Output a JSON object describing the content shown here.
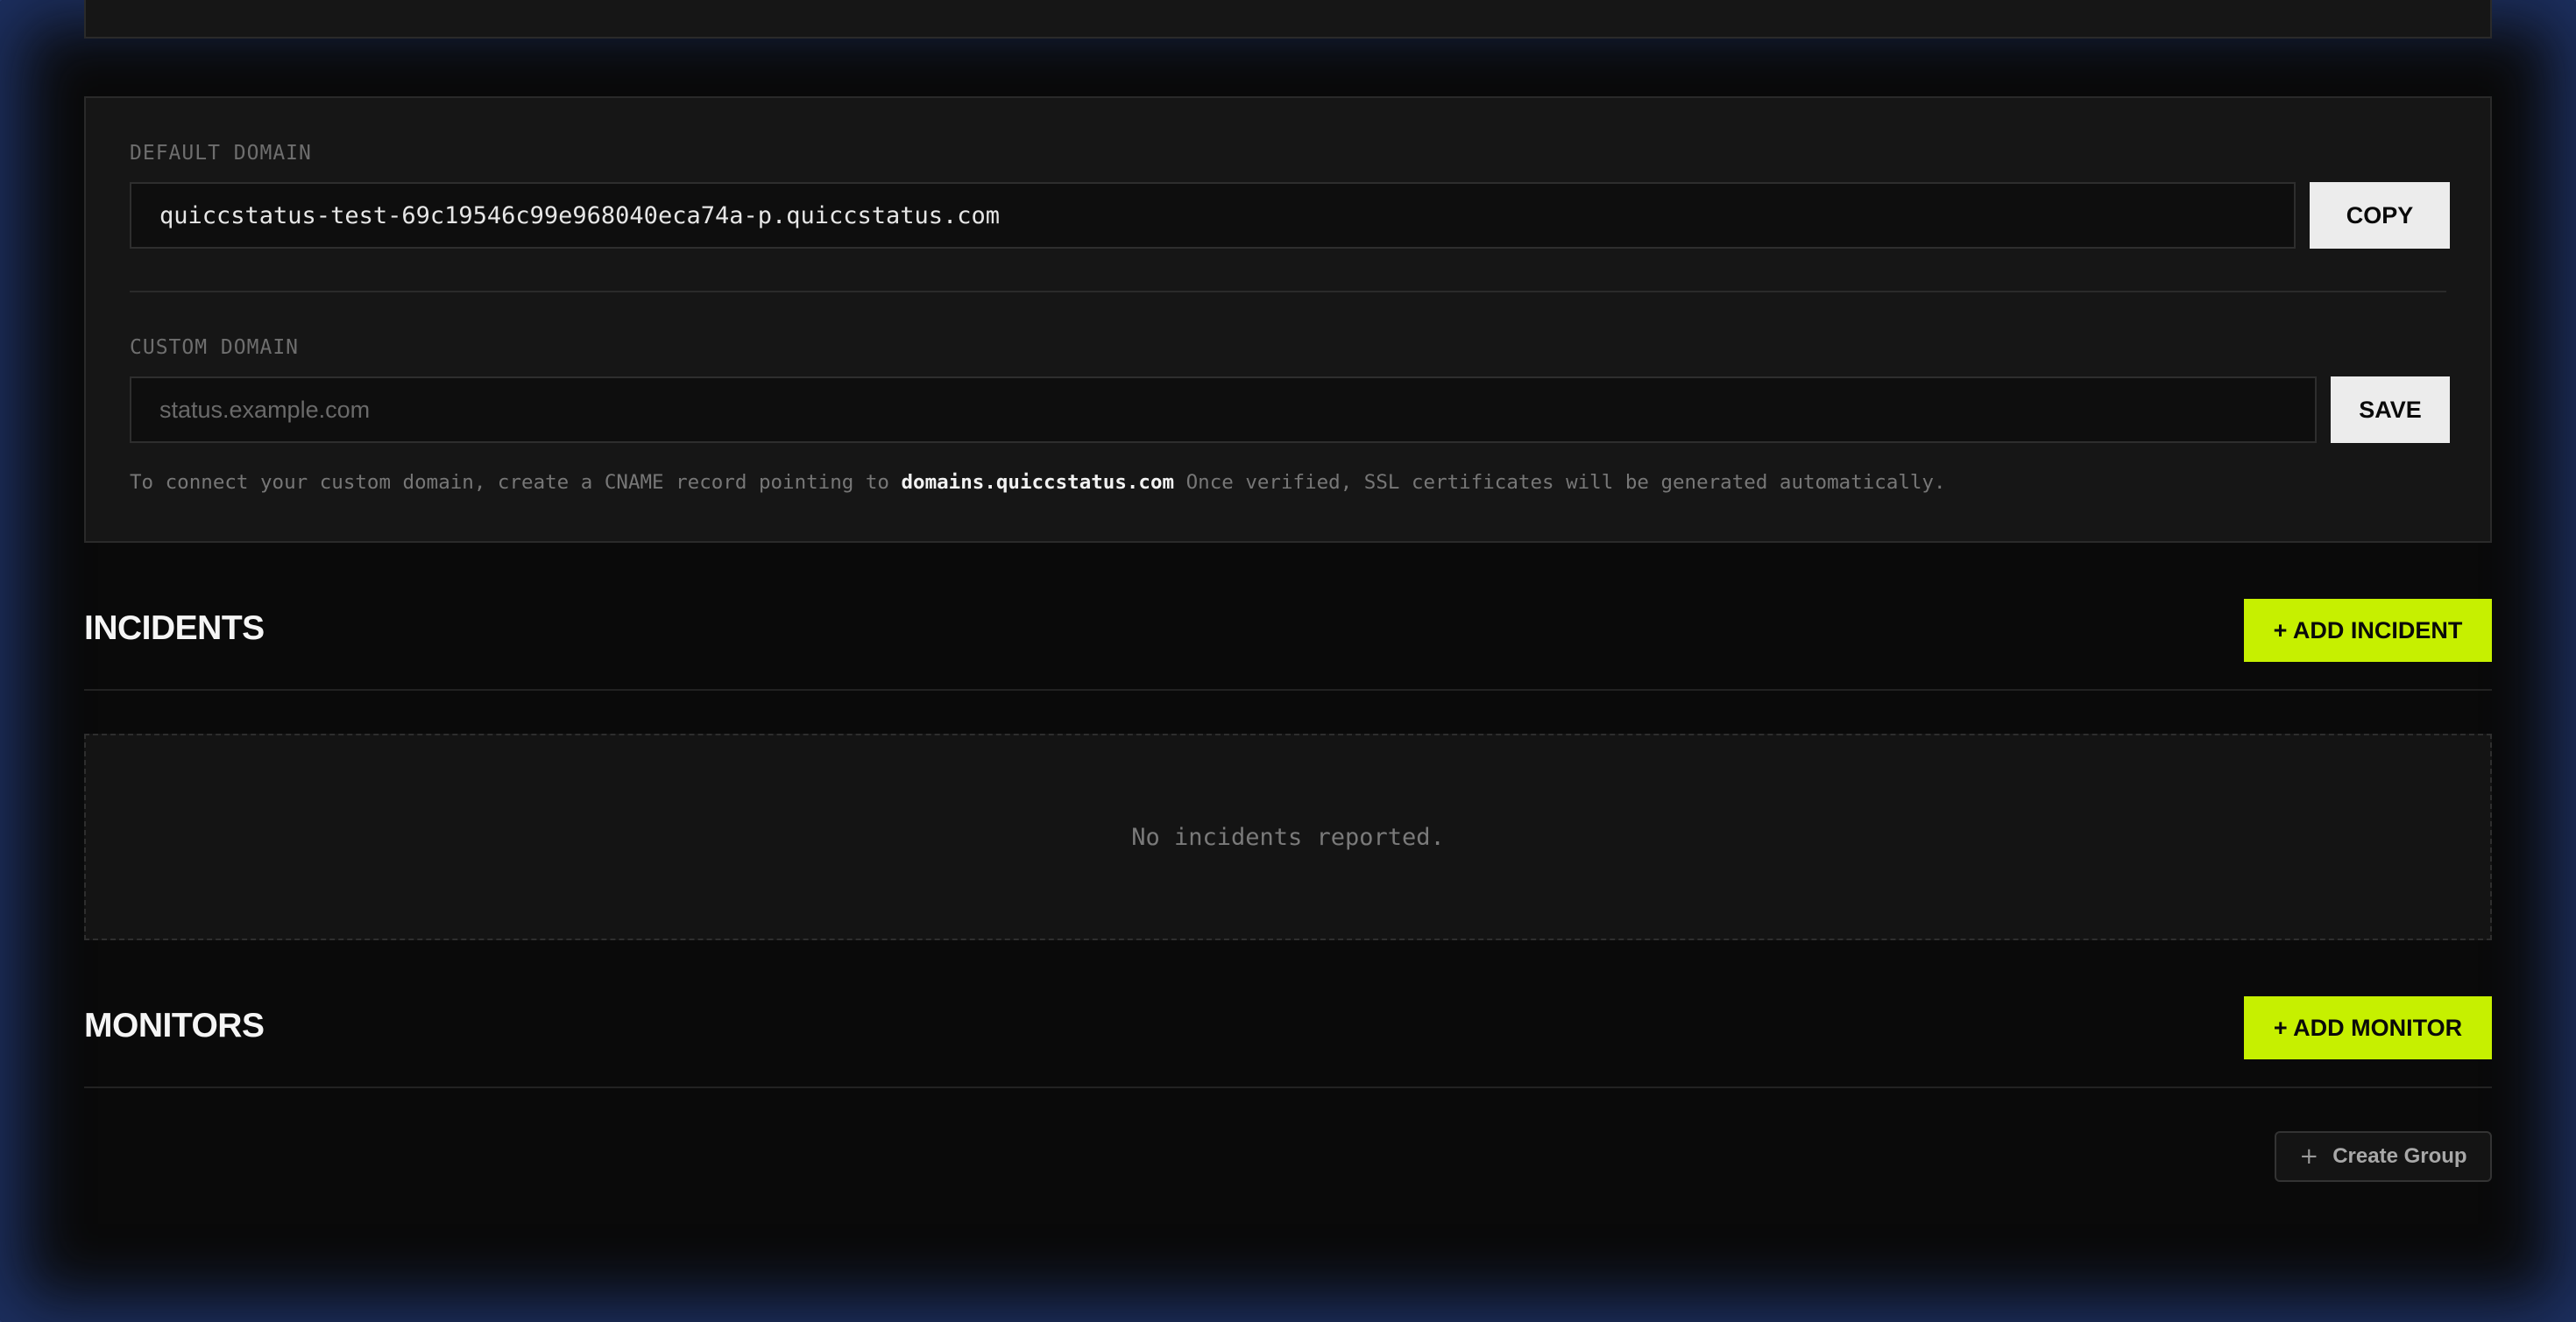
{
  "default_domain": {
    "label": "DEFAULT DOMAIN",
    "value": "quiccstatus-test-69c19546c99e968040eca74a-p.quiccstatus.com",
    "copy_label": "COPY"
  },
  "custom_domain": {
    "label": "CUSTOM DOMAIN",
    "placeholder": "status.example.com",
    "save_label": "SAVE",
    "help_prefix": "To connect your custom domain, create a CNAME record pointing to ",
    "help_target": "domains.quiccstatus.com",
    "help_suffix": " Once verified, SSL certificates will be generated automatically."
  },
  "incidents": {
    "title": "INCIDENTS",
    "add_label": "+ ADD INCIDENT",
    "empty_text": "No incidents reported."
  },
  "monitors": {
    "title": "MONITORS",
    "add_label": "+ ADD MONITOR",
    "create_group_label": "Create Group"
  },
  "colors": {
    "background": "#0a0a0a",
    "card": "#161616",
    "accent": "#c6f000",
    "light_button": "#ececec"
  }
}
